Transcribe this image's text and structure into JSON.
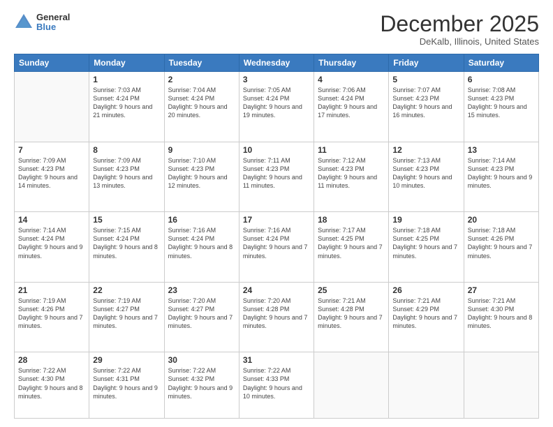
{
  "logo": {
    "text_top": "General",
    "text_bottom": "Blue"
  },
  "header": {
    "title": "December 2025",
    "location": "DeKalb, Illinois, United States"
  },
  "weekdays": [
    "Sunday",
    "Monday",
    "Tuesday",
    "Wednesday",
    "Thursday",
    "Friday",
    "Saturday"
  ],
  "weeks": [
    [
      {
        "day": "",
        "empty": true
      },
      {
        "day": "1",
        "sunrise": "7:03 AM",
        "sunset": "4:24 PM",
        "daylight": "9 hours and 21 minutes."
      },
      {
        "day": "2",
        "sunrise": "7:04 AM",
        "sunset": "4:24 PM",
        "daylight": "9 hours and 20 minutes."
      },
      {
        "day": "3",
        "sunrise": "7:05 AM",
        "sunset": "4:24 PM",
        "daylight": "9 hours and 19 minutes."
      },
      {
        "day": "4",
        "sunrise": "7:06 AM",
        "sunset": "4:24 PM",
        "daylight": "9 hours and 17 minutes."
      },
      {
        "day": "5",
        "sunrise": "7:07 AM",
        "sunset": "4:23 PM",
        "daylight": "9 hours and 16 minutes."
      },
      {
        "day": "6",
        "sunrise": "7:08 AM",
        "sunset": "4:23 PM",
        "daylight": "9 hours and 15 minutes."
      }
    ],
    [
      {
        "day": "7",
        "sunrise": "7:09 AM",
        "sunset": "4:23 PM",
        "daylight": "9 hours and 14 minutes."
      },
      {
        "day": "8",
        "sunrise": "7:09 AM",
        "sunset": "4:23 PM",
        "daylight": "9 hours and 13 minutes."
      },
      {
        "day": "9",
        "sunrise": "7:10 AM",
        "sunset": "4:23 PM",
        "daylight": "9 hours and 12 minutes."
      },
      {
        "day": "10",
        "sunrise": "7:11 AM",
        "sunset": "4:23 PM",
        "daylight": "9 hours and 11 minutes."
      },
      {
        "day": "11",
        "sunrise": "7:12 AM",
        "sunset": "4:23 PM",
        "daylight": "9 hours and 11 minutes."
      },
      {
        "day": "12",
        "sunrise": "7:13 AM",
        "sunset": "4:23 PM",
        "daylight": "9 hours and 10 minutes."
      },
      {
        "day": "13",
        "sunrise": "7:14 AM",
        "sunset": "4:23 PM",
        "daylight": "9 hours and 9 minutes."
      }
    ],
    [
      {
        "day": "14",
        "sunrise": "7:14 AM",
        "sunset": "4:24 PM",
        "daylight": "9 hours and 9 minutes."
      },
      {
        "day": "15",
        "sunrise": "7:15 AM",
        "sunset": "4:24 PM",
        "daylight": "9 hours and 8 minutes."
      },
      {
        "day": "16",
        "sunrise": "7:16 AM",
        "sunset": "4:24 PM",
        "daylight": "9 hours and 8 minutes."
      },
      {
        "day": "17",
        "sunrise": "7:16 AM",
        "sunset": "4:24 PM",
        "daylight": "9 hours and 7 minutes."
      },
      {
        "day": "18",
        "sunrise": "7:17 AM",
        "sunset": "4:25 PM",
        "daylight": "9 hours and 7 minutes."
      },
      {
        "day": "19",
        "sunrise": "7:18 AM",
        "sunset": "4:25 PM",
        "daylight": "9 hours and 7 minutes."
      },
      {
        "day": "20",
        "sunrise": "7:18 AM",
        "sunset": "4:26 PM",
        "daylight": "9 hours and 7 minutes."
      }
    ],
    [
      {
        "day": "21",
        "sunrise": "7:19 AM",
        "sunset": "4:26 PM",
        "daylight": "9 hours and 7 minutes."
      },
      {
        "day": "22",
        "sunrise": "7:19 AM",
        "sunset": "4:27 PM",
        "daylight": "9 hours and 7 minutes."
      },
      {
        "day": "23",
        "sunrise": "7:20 AM",
        "sunset": "4:27 PM",
        "daylight": "9 hours and 7 minutes."
      },
      {
        "day": "24",
        "sunrise": "7:20 AM",
        "sunset": "4:28 PM",
        "daylight": "9 hours and 7 minutes."
      },
      {
        "day": "25",
        "sunrise": "7:21 AM",
        "sunset": "4:28 PM",
        "daylight": "9 hours and 7 minutes."
      },
      {
        "day": "26",
        "sunrise": "7:21 AM",
        "sunset": "4:29 PM",
        "daylight": "9 hours and 7 minutes."
      },
      {
        "day": "27",
        "sunrise": "7:21 AM",
        "sunset": "4:30 PM",
        "daylight": "9 hours and 8 minutes."
      }
    ],
    [
      {
        "day": "28",
        "sunrise": "7:22 AM",
        "sunset": "4:30 PM",
        "daylight": "9 hours and 8 minutes."
      },
      {
        "day": "29",
        "sunrise": "7:22 AM",
        "sunset": "4:31 PM",
        "daylight": "9 hours and 9 minutes."
      },
      {
        "day": "30",
        "sunrise": "7:22 AM",
        "sunset": "4:32 PM",
        "daylight": "9 hours and 9 minutes."
      },
      {
        "day": "31",
        "sunrise": "7:22 AM",
        "sunset": "4:33 PM",
        "daylight": "9 hours and 10 minutes."
      },
      {
        "day": "",
        "empty": true
      },
      {
        "day": "",
        "empty": true
      },
      {
        "day": "",
        "empty": true
      }
    ]
  ]
}
